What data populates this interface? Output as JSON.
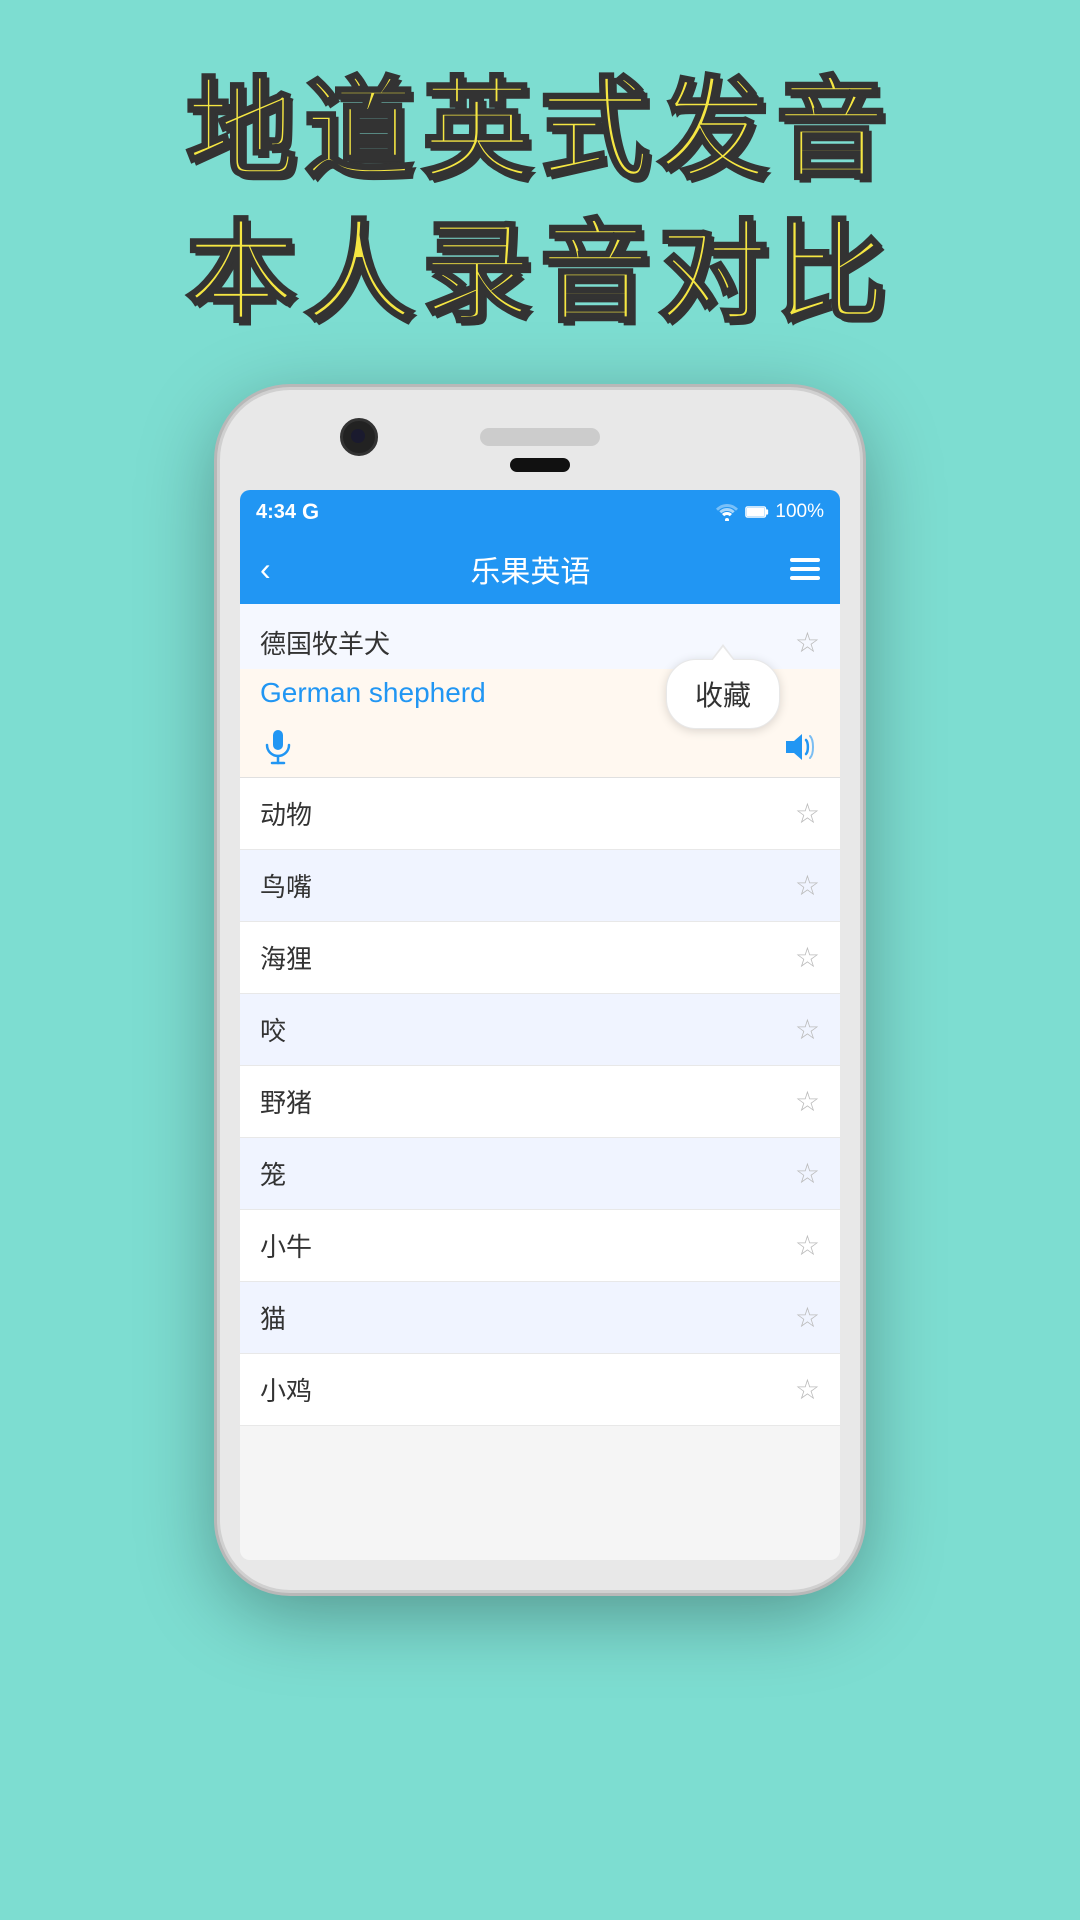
{
  "background": {
    "color": "#7DDDD1"
  },
  "headline": {
    "line1": "地道英式发音",
    "line2": "本人录音对比"
  },
  "status_bar": {
    "time": "4:34",
    "google_label": "G",
    "battery": "100%"
  },
  "app_bar": {
    "title": "乐果英语",
    "back_label": "‹",
    "menu_label": "menu"
  },
  "selected_item": {
    "chinese": "德国牧羊犬",
    "english": "German shepherd",
    "collect_label": "收藏"
  },
  "list_items": [
    {
      "id": 1,
      "text": "动物"
    },
    {
      "id": 2,
      "text": "鸟嘴"
    },
    {
      "id": 3,
      "text": "海狸"
    },
    {
      "id": 4,
      "text": "咬"
    },
    {
      "id": 5,
      "text": "野猪"
    },
    {
      "id": 6,
      "text": "笼"
    },
    {
      "id": 7,
      "text": "小牛"
    },
    {
      "id": 8,
      "text": "猫"
    },
    {
      "id": 9,
      "text": "小鸡"
    }
  ]
}
